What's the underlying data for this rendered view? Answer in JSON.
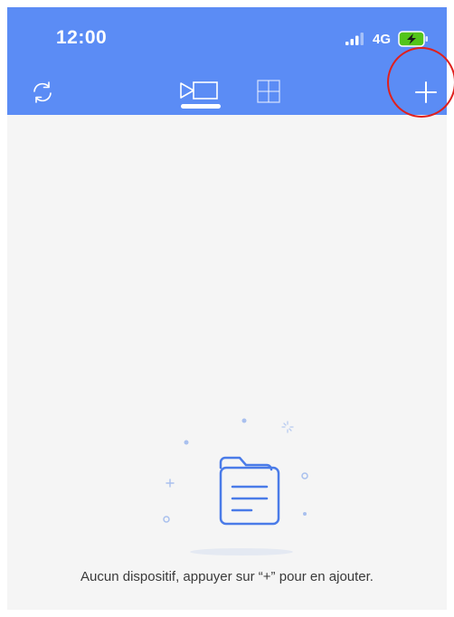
{
  "status_bar": {
    "time": "12:00",
    "network": "4G"
  },
  "toolbar": {
    "icons": {
      "refresh": "refresh-icon",
      "single_view": "single-view-icon",
      "grid_view": "grid-view-icon",
      "add": "plus-icon"
    }
  },
  "empty_state": {
    "message": "Aucun dispositif, appuyer sur “+” pour en ajouter.",
    "icon": "folder-document-icon"
  },
  "colors": {
    "header": "#5b8cf5",
    "background": "#f5f5f5",
    "accent": "#4a7be8",
    "annotation": "#e0201d",
    "battery": "#52c41a"
  }
}
